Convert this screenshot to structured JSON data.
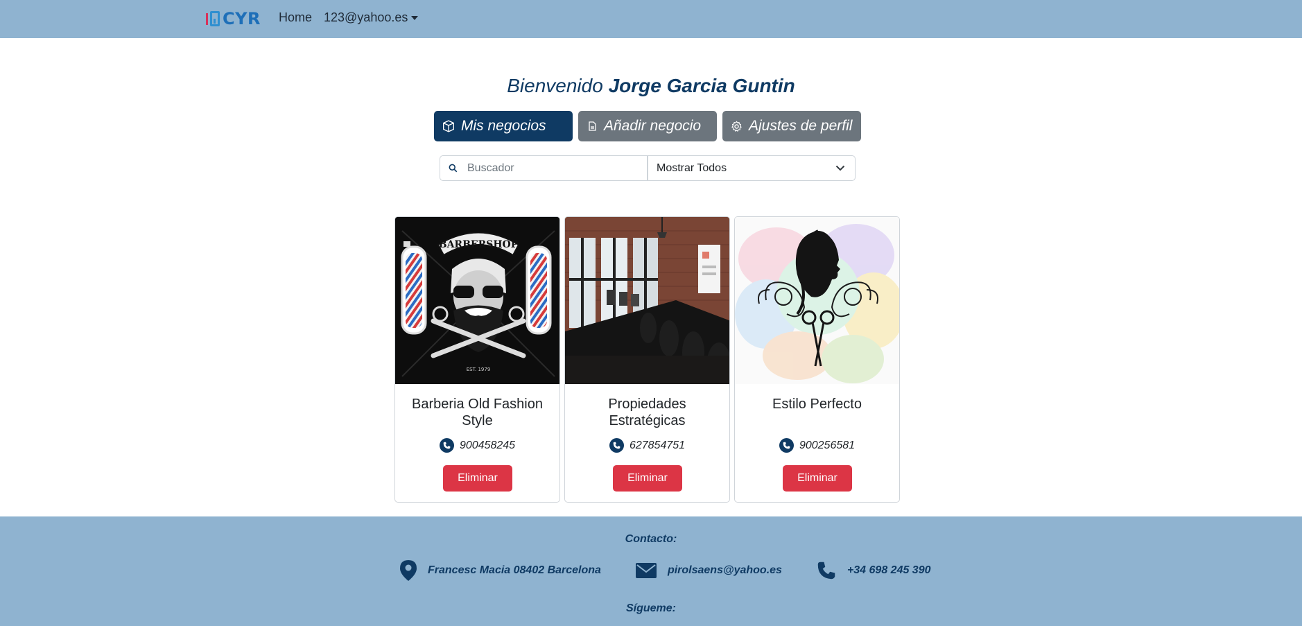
{
  "navbar": {
    "brand": "CYR",
    "home_label": "Home",
    "user_label": "123@yahoo.es"
  },
  "welcome": {
    "prefix": "Bienvenido",
    "name": "Jorge Garcia Guntin"
  },
  "tabs": [
    {
      "label": "Mis negocios",
      "icon": "box-icon",
      "active": true
    },
    {
      "label": "Añadir negocio",
      "icon": "document-icon",
      "active": false
    },
    {
      "label": "Ajustes de perfil",
      "icon": "gear-icon",
      "active": false
    }
  ],
  "search": {
    "placeholder": "Buscador",
    "value": ""
  },
  "filter": {
    "selected": "Mostrar Todos"
  },
  "businesses": [
    {
      "name": "Barberia Old Fashion Style",
      "phone": "900458245",
      "delete_label": "Eliminar",
      "image": "barbershop-logo"
    },
    {
      "name": "Propiedades Estratégicas",
      "phone": "627854751",
      "delete_label": "Eliminar",
      "image": "office-photo"
    },
    {
      "name": "Estilo Perfecto",
      "phone": "900256581",
      "delete_label": "Eliminar",
      "image": "salon-logo"
    }
  ],
  "barber_logo": {
    "banner": "BARBERSHOP",
    "est": "EST. 1979"
  },
  "footer": {
    "contact_title": "Contacto:",
    "address": "Francesc Macia 08402 Barcelona",
    "email": "pirolsaens@yahoo.es",
    "phone": "+34 698 245 390",
    "follow_title": "Sígueme:"
  },
  "colors": {
    "navbar": "#8fb3d0",
    "primary": "#0f3a63",
    "secondary": "#6c757d",
    "danger": "#dc3545"
  }
}
